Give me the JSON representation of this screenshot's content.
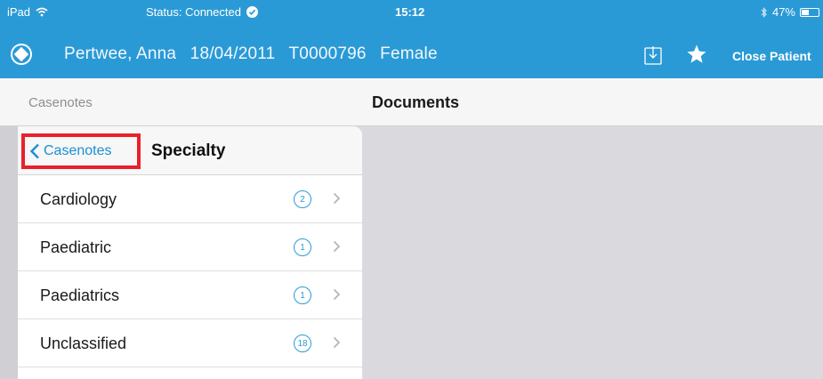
{
  "statusbar": {
    "device": "iPad",
    "status": "Status: Connected",
    "time": "15:12",
    "battery": "47%",
    "battery_level": 0.47
  },
  "patient": {
    "name": "Pertwee, Anna",
    "dob": "18/04/2011",
    "id": "T0000796",
    "gender": "Female"
  },
  "toolbar": {
    "close_label": "Close Patient"
  },
  "navbar": {
    "left_label": "Casenotes",
    "title": "Documents"
  },
  "panel": {
    "back_label": "Casenotes",
    "title": "Specialty",
    "items": [
      {
        "label": "Cardiology",
        "count": "2"
      },
      {
        "label": "Paediatric",
        "count": "1"
      },
      {
        "label": "Paediatrics",
        "count": "1"
      },
      {
        "label": "Unclassified",
        "count": "18"
      }
    ]
  },
  "colors": {
    "accent": "#2a9ad6",
    "highlight": "#e8212a",
    "link": "#1b8fd2"
  },
  "icons": {
    "wifi": "wifi-icon",
    "connected": "check-circle-icon",
    "bluetooth": "bluetooth-icon",
    "battery": "battery-icon",
    "logo": "app-logo-icon",
    "download": "download-icon",
    "favorite": "star-icon",
    "back": "chevron-left-icon",
    "disclosure": "chevron-right-icon"
  }
}
